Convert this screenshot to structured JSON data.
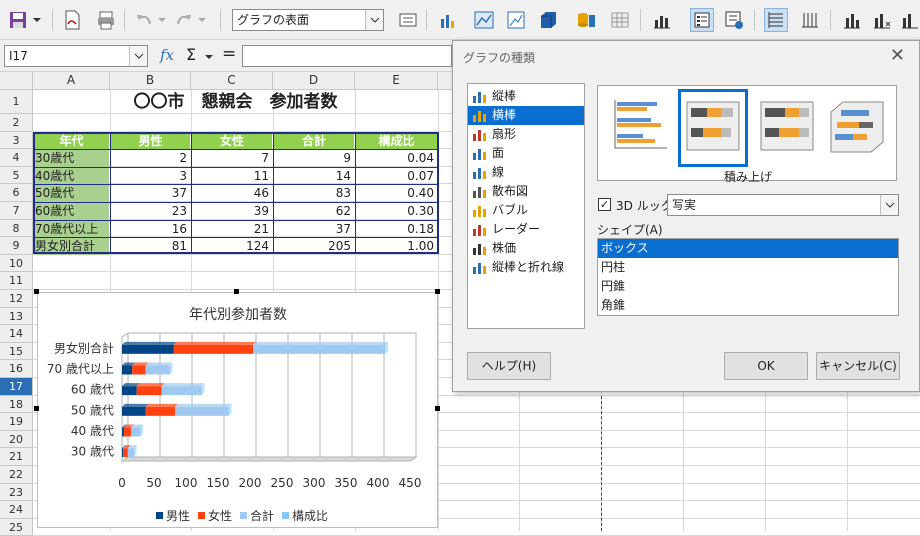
{
  "toolbar": {
    "style_combo": "グラフの表面"
  },
  "formula": {
    "cell_ref": "I17",
    "fx": "fx",
    "sum": "Σ",
    "eq": "="
  },
  "sheet": {
    "columns": [
      "A",
      "B",
      "C",
      "D",
      "E"
    ],
    "rows": [
      "1",
      "2",
      "3",
      "4",
      "5",
      "6",
      "7",
      "8",
      "9",
      "10",
      "11",
      "12",
      "13",
      "14",
      "15",
      "16",
      "17",
      "18",
      "19",
      "20",
      "21",
      "22",
      "23",
      "24",
      "25"
    ],
    "selected_row": "17",
    "title": "〇〇市　懇親会　参加者数",
    "headers": [
      "年代",
      "男性",
      "女性",
      "合計",
      "構成比"
    ],
    "data": [
      [
        "30歳代",
        "2",
        "7",
        "9",
        "0.04"
      ],
      [
        "40歳代",
        "3",
        "11",
        "14",
        "0.07"
      ],
      [
        "50歳代",
        "37",
        "46",
        "83",
        "0.40"
      ],
      [
        "60歳代",
        "23",
        "39",
        "62",
        "0.30"
      ],
      [
        "70歳代以上",
        "16",
        "21",
        "37",
        "0.18"
      ],
      [
        "男女別合計",
        "81",
        "124",
        "205",
        "1.00"
      ]
    ]
  },
  "chart_data": {
    "type": "bar",
    "orientation": "horizontal",
    "stacked": true,
    "title": "年代別参加者数",
    "categories": [
      "男女別合計",
      "70 歳代以上",
      "60 歳代",
      "50 歳代",
      "40 歳代",
      "30 歳代"
    ],
    "series": [
      {
        "name": "男性",
        "values": [
          81,
          16,
          23,
          37,
          3,
          2
        ],
        "color": "#004586"
      },
      {
        "name": "女性",
        "values": [
          124,
          21,
          39,
          46,
          11,
          7
        ],
        "color": "#ff420e"
      },
      {
        "name": "合計",
        "values": [
          205,
          37,
          62,
          83,
          14,
          9
        ],
        "color": "#9fc9f0"
      },
      {
        "name": "構成比",
        "values": [
          1.0,
          0.18,
          0.3,
          0.4,
          0.07,
          0.04
        ],
        "color": "#83caff"
      }
    ],
    "xticks": [
      "0",
      "50",
      "100",
      "150",
      "200",
      "250",
      "300",
      "350",
      "400",
      "450"
    ],
    "xlim": [
      0,
      450
    ],
    "legend": "bottom",
    "grid": true
  },
  "dialog": {
    "title": "グラフの種類",
    "close": "✕",
    "types": [
      "縦棒",
      "横棒",
      "扇形",
      "面",
      "線",
      "散布図",
      "バブル",
      "レーダー",
      "株価",
      "縦棒と折れ線"
    ],
    "selected_type": 1,
    "variant_label": "積み上げ",
    "look3d_label": "3D ルック",
    "look3d_checked": "✓",
    "look3d_value": "写実",
    "shape_label": "シェイプ(A)",
    "shapes": [
      "ボックス",
      "円柱",
      "円錐",
      "角錐"
    ],
    "selected_shape": 0,
    "help": "ヘルプ(H)",
    "ok": "OK",
    "cancel": "キャンセル(C)"
  }
}
